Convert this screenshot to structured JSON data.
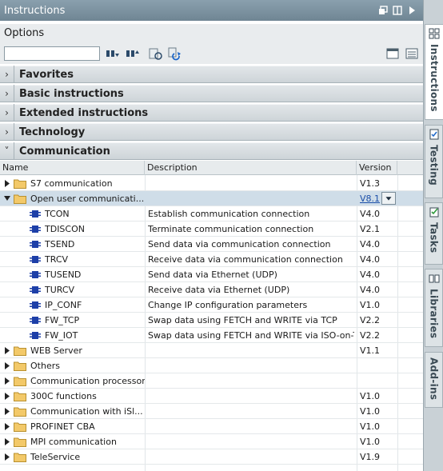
{
  "panel": {
    "title": "Instructions",
    "options_label": "Options",
    "search_value": ""
  },
  "sections": {
    "favorites": "Favorites",
    "basic": "Basic instructions",
    "extended": "Extended instructions",
    "technology": "Technology",
    "communication": "Communication"
  },
  "table": {
    "headers": {
      "name": "Name",
      "description": "Description",
      "version": "Version"
    },
    "rows": [
      {
        "name": "S7 communication",
        "desc": "",
        "ver": "V1.3"
      },
      {
        "name": "Open user communicati...",
        "desc": "",
        "ver": "V8.1"
      },
      {
        "name": "TCON",
        "desc": "Establish communication connection",
        "ver": "V4.0"
      },
      {
        "name": "TDISCON",
        "desc": "Terminate communication connection",
        "ver": "V2.1"
      },
      {
        "name": "TSEND",
        "desc": "Send data via communication connection",
        "ver": "V4.0"
      },
      {
        "name": "TRCV",
        "desc": "Receive data via communication connection",
        "ver": "V4.0"
      },
      {
        "name": "TUSEND",
        "desc": "Send data via Ethernet (UDP)",
        "ver": "V4.0"
      },
      {
        "name": "TURCV",
        "desc": "Receive data via Ethernet (UDP)",
        "ver": "V4.0"
      },
      {
        "name": "IP_CONF",
        "desc": "Change IP configuration parameters",
        "ver": "V1.0"
      },
      {
        "name": "FW_TCP",
        "desc": "Swap data using FETCH and WRITE via TCP",
        "ver": "V2.2"
      },
      {
        "name": "FW_IOT",
        "desc": "Swap data using FETCH and WRITE via ISO-on-T...",
        "ver": "V2.2"
      },
      {
        "name": "WEB Server",
        "desc": "",
        "ver": "V1.1"
      },
      {
        "name": "Others",
        "desc": "",
        "ver": ""
      },
      {
        "name": "Communication processor",
        "desc": "",
        "ver": ""
      },
      {
        "name": "300C functions",
        "desc": "",
        "ver": "V1.0"
      },
      {
        "name": "Communication with iSl...",
        "desc": "",
        "ver": "V1.0"
      },
      {
        "name": "PROFINET CBA",
        "desc": "",
        "ver": "V1.0"
      },
      {
        "name": "MPI communication",
        "desc": "",
        "ver": "V1.0"
      },
      {
        "name": "TeleService",
        "desc": "",
        "ver": "V1.9"
      }
    ]
  },
  "vtabs": {
    "instructions": "Instructions",
    "testing": "Testing",
    "tasks": "Tasks",
    "libraries": "Libraries",
    "addins": "Add-ins"
  },
  "colors": {
    "accent": "#1a4ea8",
    "selected_row": "#cfdde8",
    "titlebar": "#7b909e",
    "folder": "#f3c969"
  }
}
